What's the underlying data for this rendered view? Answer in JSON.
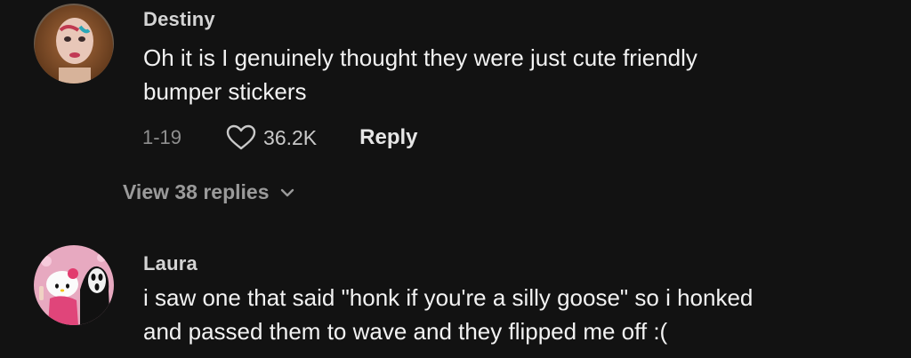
{
  "comments": [
    {
      "username": "Destiny",
      "text_line1": "Oh it is I genuinely thought they were just cute friendly",
      "text_line2": "bumper stickers",
      "date": "1-19",
      "likes": "36.2K",
      "reply_label": "Reply",
      "view_replies": "View 38 replies"
    },
    {
      "username": "Laura",
      "text_line1": "i saw one that said \"honk if you're a silly goose\" so i honked",
      "text_line2": "and passed them to wave and they flipped me off :("
    }
  ],
  "icons": {
    "like": "heart-outline-icon",
    "expand": "chevron-down-icon"
  },
  "colors": {
    "background": "#121212",
    "username": "#d4d4d4",
    "body_text": "#f2f2f2",
    "secondary_text": "#8f8f8f"
  }
}
